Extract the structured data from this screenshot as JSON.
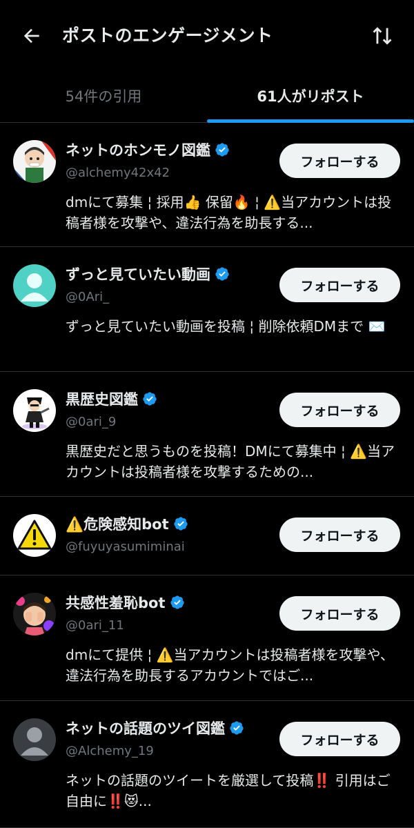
{
  "header": {
    "title": "ポストのエンゲージメント",
    "back_icon": "arrow-left-icon",
    "sort_icon": "sort-arrows-icon"
  },
  "tabs": [
    {
      "label": "54件の引用",
      "active": false
    },
    {
      "label": "61人がリポスト",
      "active": true
    }
  ],
  "colors": {
    "accent": "#1d9bf0",
    "background": "#000000",
    "secondary_text": "#71767b",
    "follow_button_bg": "#eff3f4"
  },
  "users": [
    {
      "name": "ネットのホンモノ図鑑",
      "handle": "@alchemy42x42",
      "verified": true,
      "follow_label": "フォローする",
      "bio": "dmにて募集 ¦ 採用👍 保留🔥 ¦ ⚠️当アカウントは投稿者様を攻撃や、違法行為を助長する..."
    },
    {
      "name": "ずっと見ていたい動画",
      "handle": "@0Ari_",
      "verified": true,
      "follow_label": "フォローする",
      "bio": "ずっと見ていたい動画を投稿 ¦ 削除依頼DMまで ✉️"
    },
    {
      "name": "黒歴史図鑑",
      "handle": "@0ari_9",
      "verified": true,
      "follow_label": "フォローする",
      "bio": "黒歴史だと思うものを投稿！DMにて募集中 ¦ ⚠️当アカウントは投稿者様を攻撃するための..."
    },
    {
      "name": "⚠️危険感知bot",
      "handle": "@fuyuyasumiminai",
      "verified": true,
      "follow_label": "フォローする",
      "bio": ""
    },
    {
      "name": "共感性羞恥bot",
      "handle": "@0ari_11",
      "verified": true,
      "follow_label": "フォローする",
      "bio": "dmにて提供 ¦ ⚠️当アカウントは投稿者様を攻撃や、違法行為を助長するアカウントではご..."
    },
    {
      "name": "ネットの話題のツイ図鑑",
      "handle": "@Alchemy_19",
      "verified": true,
      "follow_label": "フォローする",
      "bio": "ネットの話題のツイートを厳選して投稿‼️ 引用はご自由に‼️😻..."
    }
  ]
}
